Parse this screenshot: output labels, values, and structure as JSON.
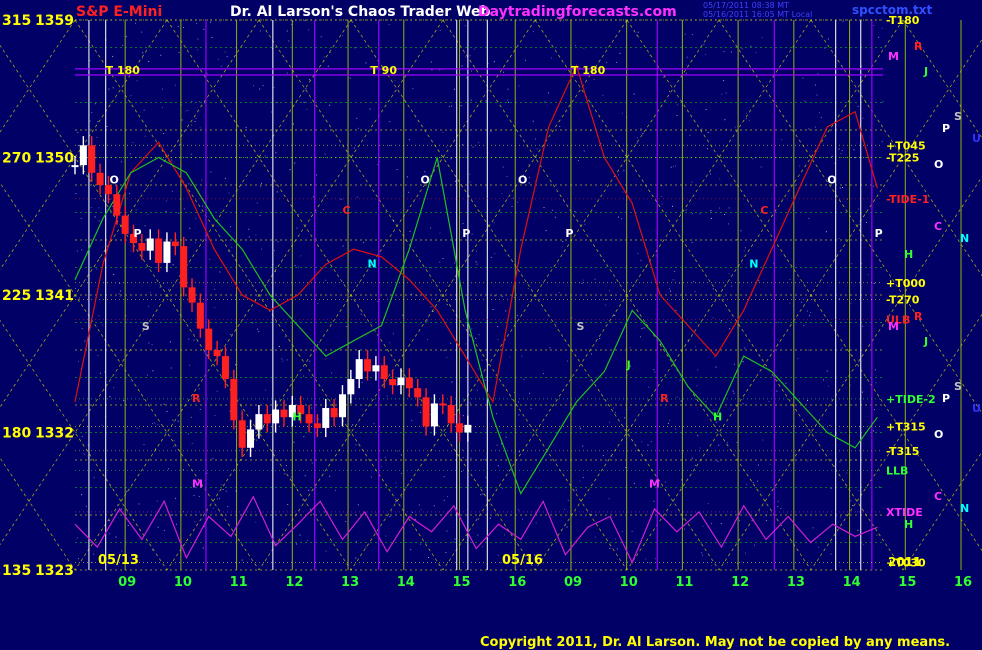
{
  "header": {
    "instrument": "S&P E-Mini",
    "title": "Dr. Al Larson's Chaos Trader Web",
    "site": "Daytradingforecasts.com",
    "stamp1": "05/17/2011 08:38 MT",
    "stamp2": "05/16/2011 16:05 MT Local",
    "file": "spcctom.txt"
  },
  "footer": {
    "copyright": "Copyright 2011, Dr. Al Larson. May not be copied by any means."
  },
  "colors": {
    "background": "#000066",
    "grid_yellow": "#e6e600",
    "grid_green": "#00c800",
    "up_candle": "#ffffff",
    "down_candle": "#ff2020",
    "red_line": "#e01010",
    "green_line": "#20c020",
    "magenta_line": "#d020d0",
    "purple_line": "#a000ff"
  },
  "chart_data": {
    "type": "line",
    "title": "S&P E-Mini",
    "ylim": [
      1323,
      1359
    ],
    "y_price_ticks": [
      1323,
      1332,
      1341,
      1350,
      1359
    ],
    "y_degree_ticks": [
      "135",
      "180",
      "225",
      "270",
      "315"
    ],
    "session_labels": [
      "05/13",
      "05/16"
    ],
    "hour_ticks": [
      "09",
      "10",
      "11",
      "12",
      "13",
      "14",
      "15",
      "16",
      "09",
      "10",
      "11",
      "12",
      "13",
      "14",
      "15",
      "16"
    ],
    "year_label": "2011",
    "tide_markers": [
      "T 180",
      "T 90",
      "T 180"
    ],
    "right_levels": [
      {
        "label": "-T180",
        "price": 1359,
        "color": "#ffff00"
      },
      {
        "label": "+T045",
        "price": 1350.8,
        "color": "#ffff00"
      },
      {
        "label": "-T225",
        "price": 1350,
        "color": "#ffff00"
      },
      {
        "label": "-TIDE-1",
        "price": 1347.3,
        "color": "#ff2020"
      },
      {
        "label": "+T000",
        "price": 1341.8,
        "color": "#ffff00"
      },
      {
        "label": "-T270",
        "price": 1340.7,
        "color": "#ffff00"
      },
      {
        "label": "ULB",
        "price": 1339.4,
        "color": "#ff2020"
      },
      {
        "label": "+TIDE-2",
        "price": 1334.2,
        "color": "#30ff30"
      },
      {
        "label": "+T315",
        "price": 1332.4,
        "color": "#ffff00"
      },
      {
        "label": "-T315",
        "price": 1330.8,
        "color": "#ffff00"
      },
      {
        "label": "LLB",
        "price": 1329.5,
        "color": "#30ff30"
      },
      {
        "label": "XTIDE",
        "price": 1326.8,
        "color": "#ff30ff"
      },
      {
        "label": "+T030",
        "price": 1323.5,
        "color": "#ffff00"
      }
    ],
    "planet_letters_right": [
      {
        "t": "R",
        "c": "#ff2020"
      },
      {
        "t": "M",
        "c": "#ff30ff"
      },
      {
        "t": "J",
        "c": "#30ff30"
      },
      {
        "t": "S",
        "c": "#c0c0c0"
      },
      {
        "t": "U",
        "c": "#3030ff"
      },
      {
        "t": "P",
        "c": "#ffffff"
      },
      {
        "t": "O",
        "c": "#ffffff"
      },
      {
        "t": "C",
        "c": "#ff30ff"
      },
      {
        "t": "N",
        "c": "#00ffff"
      },
      {
        "t": "H",
        "c": "#30ff30"
      },
      {
        "t": "R",
        "c": "#ff2020"
      },
      {
        "t": "M",
        "c": "#ff30ff"
      },
      {
        "t": "J",
        "c": "#30ff30"
      },
      {
        "t": "S",
        "c": "#c0c0c0"
      },
      {
        "t": "U",
        "c": "#3030ff"
      },
      {
        "t": "P",
        "c": "#ffffff"
      },
      {
        "t": "O",
        "c": "#ffffff"
      },
      {
        "t": "C",
        "c": "#ff30ff"
      },
      {
        "t": "N",
        "c": "#00ffff"
      },
      {
        "t": "H",
        "c": "#30ff30"
      }
    ],
    "chart_letters": [
      {
        "t": "O",
        "c": "#ffffff",
        "x": 0.62,
        "y": 1348.3
      },
      {
        "t": "P",
        "c": "#ffffff",
        "x": 1.05,
        "y": 1344.8
      },
      {
        "t": "S",
        "c": "#c0c0c0",
        "x": 1.2,
        "y": 1338.7
      },
      {
        "t": "R",
        "c": "#ff2020",
        "x": 2.1,
        "y": 1334.0
      },
      {
        "t": "M",
        "c": "#ff30ff",
        "x": 2.1,
        "y": 1328.4
      },
      {
        "t": "H",
        "c": "#30ff30",
        "x": 3.9,
        "y": 1332.8
      },
      {
        "t": "C",
        "c": "#ff2020",
        "x": 4.8,
        "y": 1346.3
      },
      {
        "t": "N",
        "c": "#00ffff",
        "x": 5.25,
        "y": 1342.8
      },
      {
        "t": "O",
        "c": "#ffffff",
        "x": 6.2,
        "y": 1348.3
      },
      {
        "t": "P",
        "c": "#ffffff",
        "x": 6.95,
        "y": 1344.8
      },
      {
        "t": "O",
        "c": "#ffffff",
        "x": 7.95,
        "y": 1348.3
      },
      {
        "t": "P",
        "c": "#ffffff",
        "x": 8.8,
        "y": 1344.8
      },
      {
        "t": "S",
        "c": "#c0c0c0",
        "x": 9.0,
        "y": 1338.7
      },
      {
        "t": "J",
        "c": "#30ff30",
        "x": 9.9,
        "y": 1336.2
      },
      {
        "t": "R",
        "c": "#ff2020",
        "x": 10.5,
        "y": 1334.0
      },
      {
        "t": "M",
        "c": "#ff30ff",
        "x": 10.3,
        "y": 1328.4
      },
      {
        "t": "H",
        "c": "#30ff30",
        "x": 11.45,
        "y": 1332.8
      },
      {
        "t": "N",
        "c": "#00ffff",
        "x": 12.1,
        "y": 1342.8
      },
      {
        "t": "C",
        "c": "#ff2020",
        "x": 12.3,
        "y": 1346.3
      },
      {
        "t": "O",
        "c": "#ffffff",
        "x": 13.5,
        "y": 1348.3
      },
      {
        "t": "P",
        "c": "#ffffff",
        "x": 14.35,
        "y": 1344.8
      }
    ],
    "price_series": {
      "name": "price",
      "x": [
        0.0,
        0.15,
        0.3,
        0.45,
        0.6,
        0.75,
        0.9,
        1.05,
        1.2,
        1.35,
        1.5,
        1.65,
        1.8,
        1.95,
        2.1,
        2.25,
        2.4,
        2.55,
        2.7,
        2.85,
        3.0,
        3.15,
        3.3,
        3.45,
        3.6,
        3.75,
        3.9,
        4.05,
        4.2,
        4.35,
        4.5,
        4.65,
        4.8,
        4.95,
        5.1,
        5.25,
        5.4,
        5.55,
        5.7,
        5.85,
        6.0,
        6.15,
        6.3,
        6.45,
        6.6,
        6.75,
        6.9,
        7.05
      ],
      "close": [
        1349.5,
        1350.8,
        1349.0,
        1348.2,
        1347.6,
        1346.2,
        1345.0,
        1344.4,
        1343.9,
        1344.7,
        1343.1,
        1344.5,
        1344.2,
        1341.5,
        1340.5,
        1338.8,
        1337.4,
        1337.0,
        1335.5,
        1332.8,
        1331.0,
        1332.2,
        1333.2,
        1332.6,
        1333.5,
        1333.0,
        1333.8,
        1333.2,
        1332.6,
        1332.3,
        1333.6,
        1333.0,
        1334.5,
        1335.5,
        1336.8,
        1336.0,
        1336.4,
        1335.5,
        1335.1,
        1335.6,
        1334.9,
        1334.3,
        1332.4,
        1333.9,
        1333.8,
        1332.6,
        1332.0,
        1332.5
      ]
    },
    "red_series": {
      "name": "red",
      "x": [
        0,
        0.5,
        1.0,
        1.5,
        2.0,
        2.5,
        3.0,
        3.5,
        4.0,
        4.5,
        5.0,
        5.5,
        6.0,
        6.5,
        7.0,
        7.5,
        8.0,
        8.5,
        9.0,
        9.5,
        10.0,
        10.5,
        11.0,
        11.5,
        12.0,
        12.5,
        13.0,
        13.5,
        14.0,
        14.4
      ],
      "y": [
        1334,
        1343,
        1349,
        1351,
        1348,
        1344,
        1341,
        1340,
        1341,
        1343,
        1344,
        1343.5,
        1342,
        1340,
        1337,
        1334,
        1344,
        1352,
        1356,
        1350,
        1347,
        1341,
        1339,
        1337,
        1340,
        1344,
        1348,
        1352,
        1353,
        1348
      ]
    },
    "green_series": {
      "name": "green",
      "x": [
        0,
        0.5,
        1.0,
        1.5,
        2.0,
        2.5,
        3.0,
        3.5,
        4.0,
        4.5,
        5.0,
        5.5,
        6.0,
        6.5,
        7.0,
        7.5,
        8.0,
        8.5,
        9.0,
        9.5,
        10.0,
        10.5,
        11.0,
        11.5,
        12.0,
        12.5,
        13.0,
        13.5,
        14.0,
        14.4
      ],
      "y": [
        1342,
        1346,
        1349,
        1350,
        1349,
        1346,
        1344,
        1341,
        1339,
        1337,
        1338,
        1339,
        1344,
        1350,
        1340,
        1333,
        1328,
        1331,
        1334,
        1336,
        1340,
        1338,
        1335,
        1333,
        1337,
        1336,
        1334,
        1332,
        1331,
        1333
      ]
    },
    "magenta_series": {
      "name": "magenta",
      "x": [
        0,
        0.4,
        0.8,
        1.2,
        1.6,
        2.0,
        2.4,
        2.8,
        3.2,
        3.6,
        4.0,
        4.4,
        4.8,
        5.2,
        5.6,
        6.0,
        6.4,
        6.8,
        7.2,
        7.6,
        8.0,
        8.4,
        8.8,
        9.2,
        9.6,
        10.0,
        10.4,
        10.8,
        11.2,
        11.6,
        12.0,
        12.4,
        12.8,
        13.2,
        13.6,
        14.0,
        14.4
      ],
      "y": [
        1326,
        1324.5,
        1327,
        1325,
        1327.5,
        1323.8,
        1326.5,
        1325.2,
        1327.8,
        1324.6,
        1326.0,
        1327.5,
        1325.0,
        1326.8,
        1324.2,
        1326.5,
        1325.5,
        1327.2,
        1324.4,
        1326.0,
        1325.0,
        1327.5,
        1324.0,
        1325.8,
        1326.5,
        1323.5,
        1327.0,
        1325.5,
        1326.8,
        1324.5,
        1327.2,
        1325.0,
        1326.5,
        1324.8,
        1326.0,
        1325.2,
        1325.8
      ]
    }
  }
}
